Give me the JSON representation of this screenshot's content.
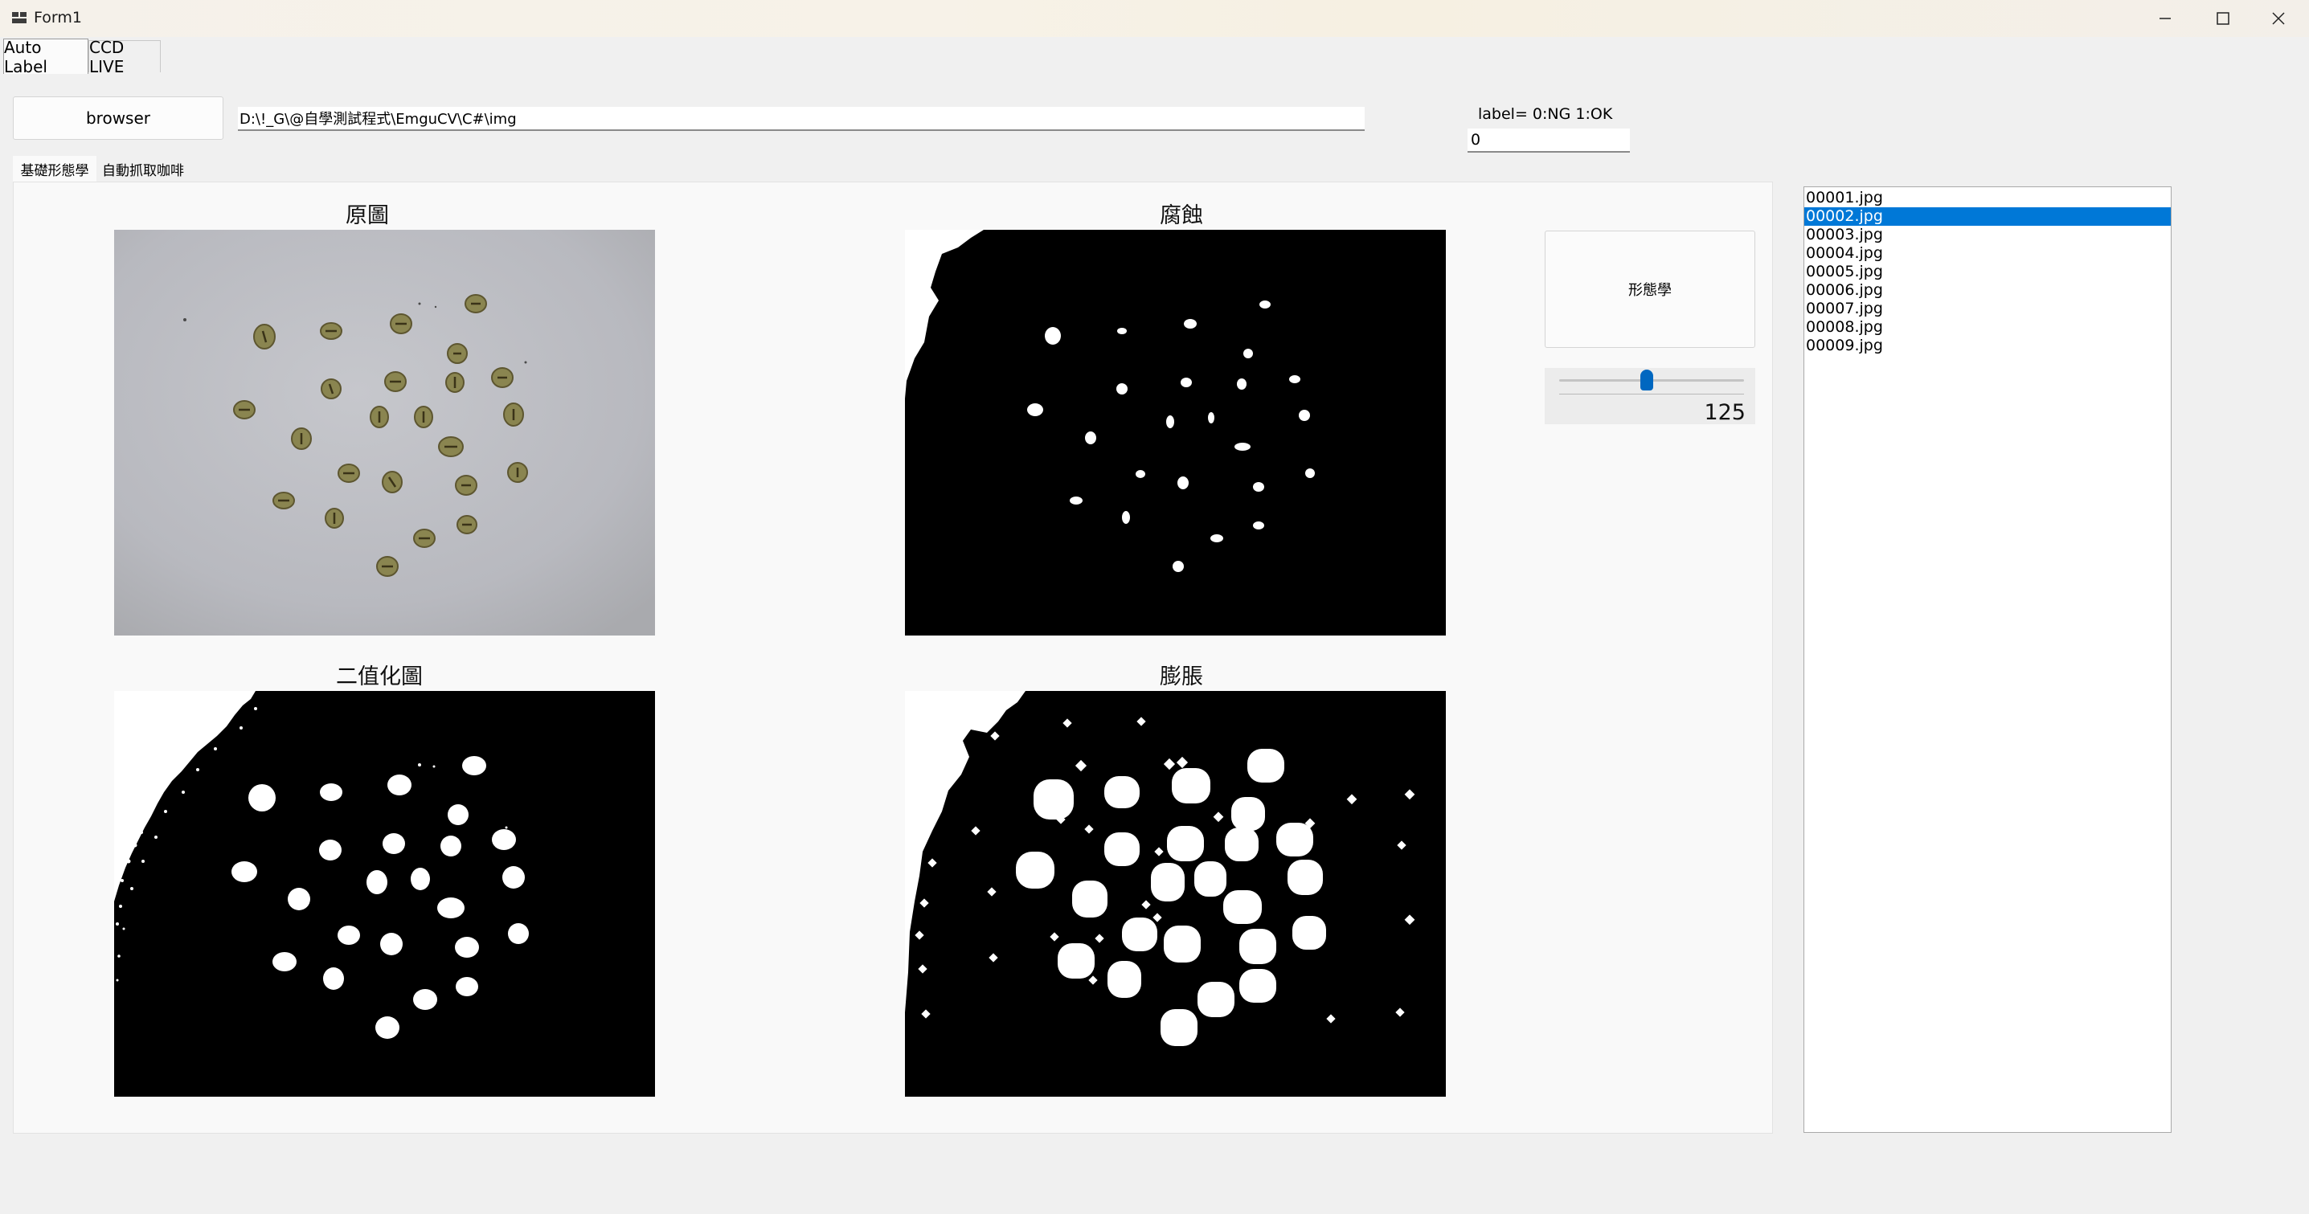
{
  "window": {
    "title": "Form1",
    "icon": "app-window-icon"
  },
  "top_tabs": [
    "Auto Label",
    "CCD LIVE"
  ],
  "browse": {
    "button_label": "browser",
    "path_value": "D:\\!_G\\@自學測試程式\\EmguCV\\C#\\img"
  },
  "label": {
    "caption": "label= 0:NG 1:OK",
    "value": "0"
  },
  "inner_tabs": [
    "基礎形態學",
    "自動抓取咖啡"
  ],
  "images": {
    "original": {
      "title": "原圖"
    },
    "erosion": {
      "title": "腐蝕"
    },
    "binary": {
      "title": "二值化圖"
    },
    "dilation": {
      "title": "膨脹"
    }
  },
  "morph_button_label": "形態學",
  "slider": {
    "value": "125",
    "min": 0,
    "max": 255
  },
  "file_list": {
    "items": [
      "00001.jpg",
      "00002.jpg",
      "00003.jpg",
      "00004.jpg",
      "00005.jpg",
      "00006.jpg",
      "00007.jpg",
      "00008.jpg",
      "00009.jpg"
    ],
    "selected": "00002.jpg"
  },
  "colors": {
    "accent": "#0078d7",
    "slider_thumb": "#0067c0"
  }
}
